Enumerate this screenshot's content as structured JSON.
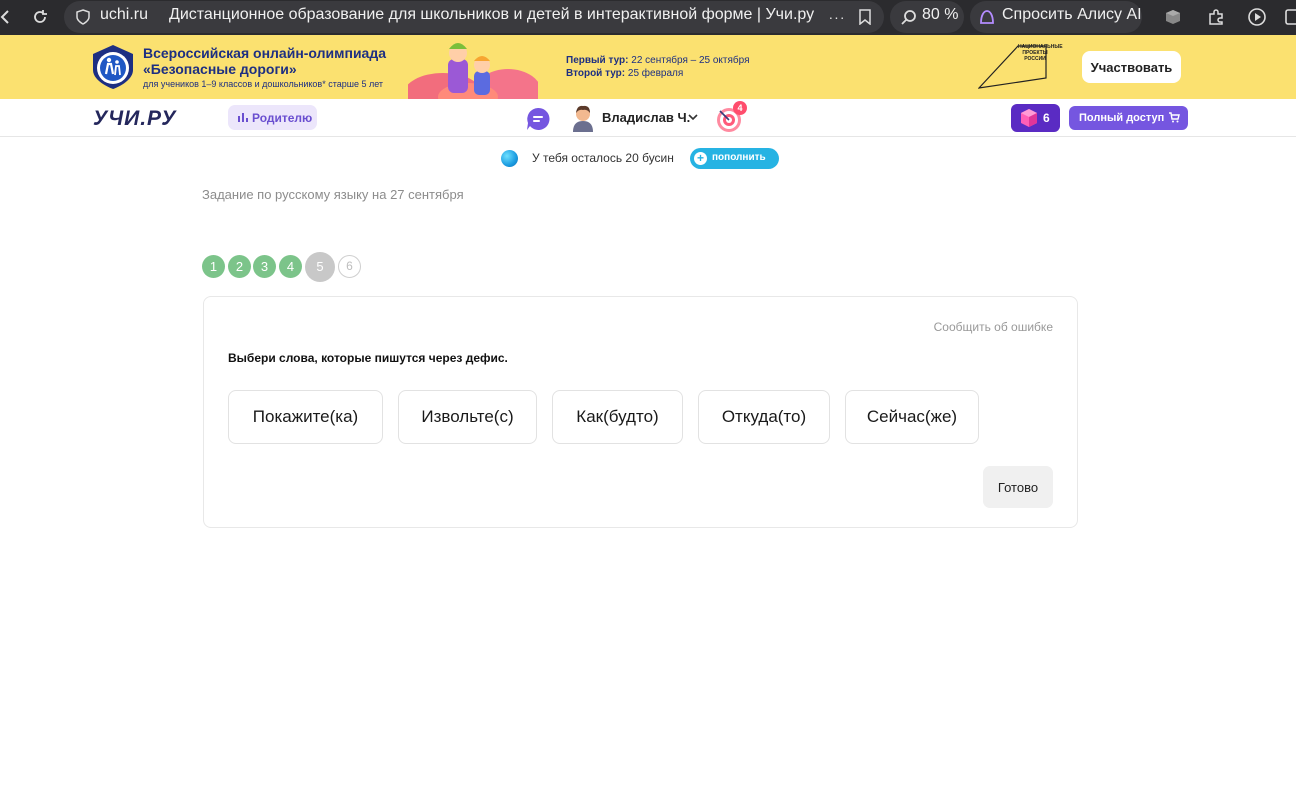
{
  "browser": {
    "domain": "uchi.ru",
    "page_title": "Дистанционное образование для школьников и детей в интерактивной форме | Учи.ру",
    "zoom": "80 %",
    "alice": "Спросить Алису AI"
  },
  "promo": {
    "title_line1": "Всероссийская онлайн-олимпиада",
    "title_line2": "«Безопасные дороги»",
    "subtitle": "для учеников 1–9 классов и дошкольников* старше 5 лет",
    "round1_label": "Первый тур:",
    "round1_dates": "22 сентября – 25 октября",
    "round2_label": "Второй тур:",
    "round2_dates": "25 февраля",
    "national_logo": "НАЦИОНАЛЬНЫЕ ПРОЕКТЫ РОССИИ",
    "cta": "Участвовать"
  },
  "header": {
    "logo": "УЧИ.РУ",
    "parent_label": "Родителю",
    "user_name": "Владислав Ч.",
    "target_badge": "4",
    "gems_count": "6",
    "full_access": "Полный доступ"
  },
  "beads": {
    "text": "У тебя осталось 20 бусин",
    "topup": "пополнить"
  },
  "task": {
    "title": "Задание по русскому языку на 27 сентября",
    "steps": [
      "1",
      "2",
      "3",
      "4",
      "5",
      "6"
    ],
    "current_step": 5,
    "report": "Сообщить об ошибке",
    "question": "Выбери слова, которые пишутся через дефис.",
    "words": [
      "Покажите(ка)",
      "Извольте(с)",
      "Как(будто)",
      "Откуда(то)",
      "Сейчас(же)"
    ],
    "done": "Готово"
  },
  "colors": {
    "promo_bg": "#fbe170",
    "brand_purple": "#7556e0",
    "step_done": "#7cc48a",
    "step_current": "#c8c8c8",
    "topup": "#26b3e3"
  }
}
